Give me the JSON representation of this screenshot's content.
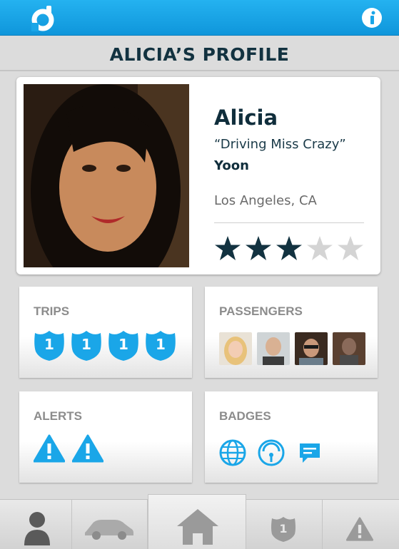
{
  "header": {
    "logo_icon": "d-logo-icon",
    "info_icon": "info-icon",
    "color": "#1aa6e8"
  },
  "page_title": "ALICIA’S PROFILE",
  "profile": {
    "first_name": "Alicia",
    "nickname": "“Driving Miss Crazy”",
    "last_name": "Yoon",
    "location": "Los Angeles, CA",
    "rating": 3,
    "rating_max": 5
  },
  "trips": {
    "label": "TRIPS",
    "badges": [
      "1",
      "1",
      "1",
      "1"
    ]
  },
  "passengers": {
    "label": "PASSENGERS",
    "avatars": [
      "blonde-woman-avatar",
      "man-avatar",
      "glasses-man-avatar",
      "older-man-avatar"
    ]
  },
  "alerts": {
    "label": "ALERTS",
    "icons": [
      "warning-icon",
      "warning-icon"
    ]
  },
  "badges": {
    "label": "BADGES",
    "icons": [
      "globe-icon",
      "gauge-icon",
      "chat-bubble-icon"
    ]
  },
  "tabbar": {
    "items": [
      "profile-icon",
      "car-icon",
      "home-icon",
      "route-shield-icon",
      "warning-icon"
    ],
    "shield_number": "1",
    "active": "home-icon"
  },
  "colors": {
    "accent": "#1aa6e8",
    "navy": "#123240",
    "star_filled": "#123240",
    "star_empty": "#d4d4d4"
  }
}
